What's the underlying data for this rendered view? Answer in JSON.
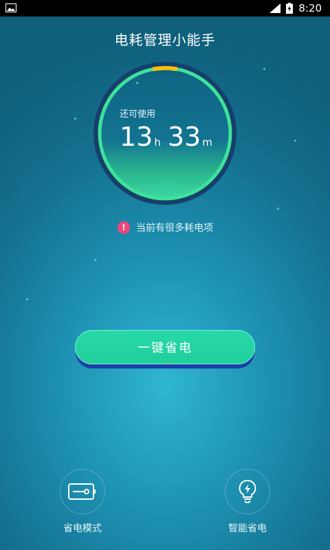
{
  "status_bar": {
    "time": "8:20"
  },
  "app": {
    "title": "电耗管理小能手"
  },
  "gauge": {
    "label": "还可使用",
    "hours": "13",
    "hours_unit": "h",
    "minutes": "33",
    "minutes_unit": "m",
    "ring_color": "#3ee29a",
    "marker_color": "#f5c20e"
  },
  "alert": {
    "icon": "exclamation-icon",
    "text": "当前有很多耗电项"
  },
  "main_button": {
    "label": "一键省电"
  },
  "modes": [
    {
      "label": "省电模式",
      "icon": "battery-mode-icon"
    },
    {
      "label": "智能省电",
      "icon": "smart-bulb-icon"
    }
  ]
}
